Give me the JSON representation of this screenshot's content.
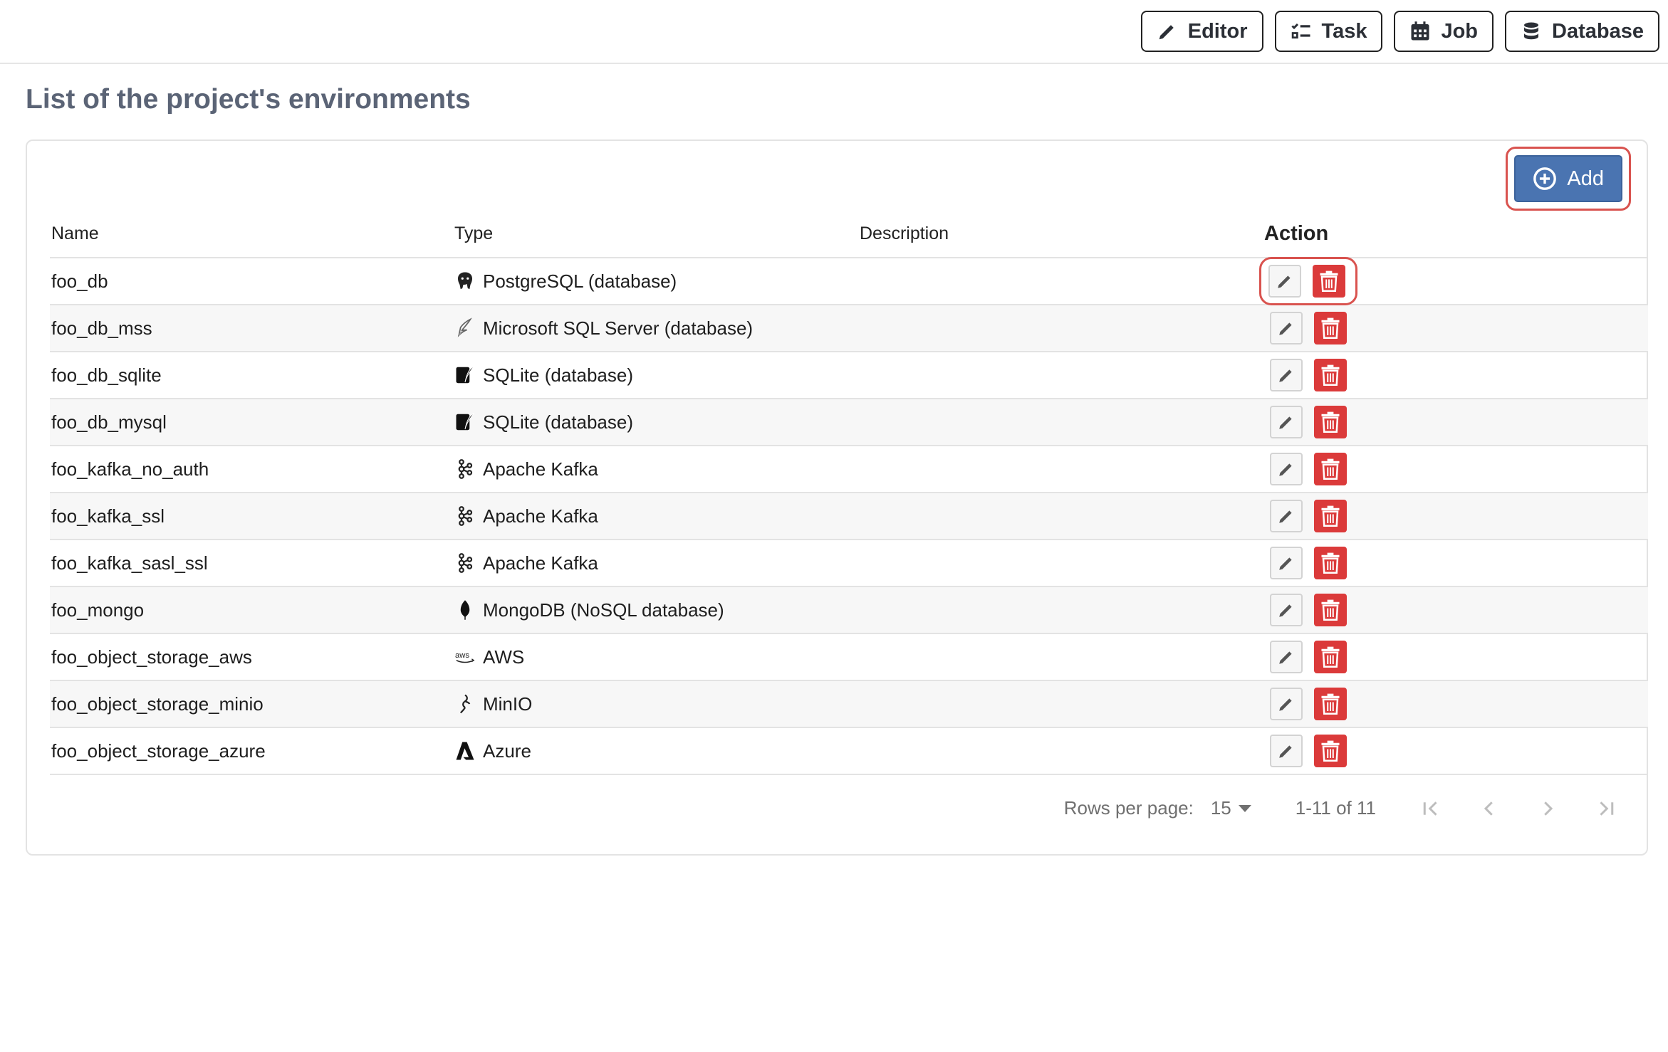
{
  "toolbar": {
    "buttons": [
      {
        "label": "Editor",
        "icon": "pencil-icon"
      },
      {
        "label": "Task",
        "icon": "checklist-icon"
      },
      {
        "label": "Job",
        "icon": "calendar-icon"
      },
      {
        "label": "Database",
        "icon": "database-icon"
      }
    ]
  },
  "page": {
    "title": "List of the project's environments"
  },
  "add_button": {
    "label": "Add",
    "icon": "plus-circle-icon"
  },
  "table": {
    "columns": [
      "Name",
      "Type",
      "Description",
      "Action"
    ],
    "rows": [
      {
        "name": "foo_db",
        "type": "PostgreSQL (database)",
        "type_icon": "postgresql-icon",
        "description": ""
      },
      {
        "name": "foo_db_mss",
        "type": "Microsoft SQL Server (database)",
        "type_icon": "mssql-icon",
        "description": ""
      },
      {
        "name": "foo_db_sqlite",
        "type": "SQLite (database)",
        "type_icon": "sqlite-icon",
        "description": ""
      },
      {
        "name": "foo_db_mysql",
        "type": "SQLite (database)",
        "type_icon": "sqlite-icon",
        "description": ""
      },
      {
        "name": "foo_kafka_no_auth",
        "type": "Apache Kafka",
        "type_icon": "kafka-icon",
        "description": ""
      },
      {
        "name": "foo_kafka_ssl",
        "type": "Apache Kafka",
        "type_icon": "kafka-icon",
        "description": ""
      },
      {
        "name": "foo_kafka_sasl_ssl",
        "type": "Apache Kafka",
        "type_icon": "kafka-icon",
        "description": ""
      },
      {
        "name": "foo_mongo",
        "type": "MongoDB (NoSQL database)",
        "type_icon": "mongodb-icon",
        "description": ""
      },
      {
        "name": "foo_object_storage_aws",
        "type": "AWS",
        "type_icon": "aws-icon",
        "description": ""
      },
      {
        "name": "foo_object_storage_minio",
        "type": "MinIO",
        "type_icon": "minio-icon",
        "description": ""
      },
      {
        "name": "foo_object_storage_azure",
        "type": "Azure",
        "type_icon": "azure-icon",
        "description": ""
      }
    ]
  },
  "pagination": {
    "rows_per_page_label": "Rows per page:",
    "rows_per_page": "15",
    "range": "1-11 of 11"
  },
  "colors": {
    "accent": "#4a74b1",
    "danger": "#db3a3a",
    "highlight": "#d9534f",
    "title": "#5b6476"
  }
}
